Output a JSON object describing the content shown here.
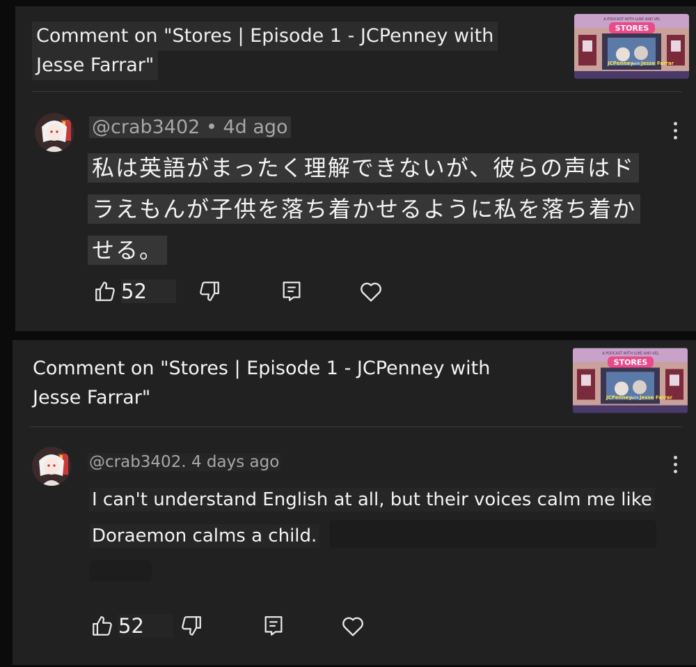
{
  "cards": [
    {
      "title_line1": "Comment on \"Stores | Episode 1 - JCPenney with",
      "title_line2": "Jesse Farrar\"",
      "thumbnail": {
        "sign": "STORES",
        "tagline": "A PODCAST WITH LUKE AND VEL",
        "guest_left": "JCPenney",
        "guest_word": "with",
        "guest_right": "Jesse Farrar"
      },
      "author": "@crab3402",
      "separator": "•",
      "time": "4d ago",
      "body_lines": [
        "私は英語がまったく理解できないが、彼らの声はド",
        "ラえもんが子供を落ち着かせるように私を落ち着か",
        "せる。"
      ],
      "likes": "52",
      "icons": [
        "thumbs-up-icon",
        "thumbs-down-icon",
        "reply-icon",
        "heart-icon",
        "more-vertical-icon"
      ]
    },
    {
      "title_line1": "Comment on \"Stores | Episode 1 - JCPenney with",
      "title_line2": "Jesse Farrar\"",
      "thumbnail": {
        "sign": "STORES",
        "tagline": "A PODCAST WITH LUKE AND VEL",
        "guest_left": "JCPenney",
        "guest_word": "with",
        "guest_right": "Jesse Farrar"
      },
      "author_time": "@crab3402. 4 days ago",
      "body_lines": [
        "I can't understand English at all, but their voices calm me like",
        "Doraemon calms a child."
      ],
      "likes": "52",
      "icons": [
        "thumbs-up-icon",
        "thumbs-down-icon",
        "reply-icon",
        "heart-icon",
        "more-vertical-icon"
      ]
    }
  ],
  "colors": {
    "page_background": "#0b0b0b",
    "card_background": "#212121",
    "text_primary": "#f2f2f2",
    "text_secondary": "#a7a7a7"
  }
}
